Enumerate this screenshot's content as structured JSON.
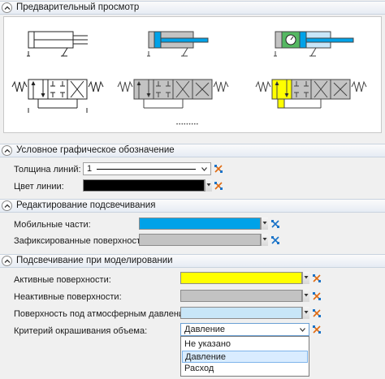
{
  "colors": {
    "accent_blue": "#00a2e8",
    "active_yellow": "#ffff00",
    "atm_lightblue": "#c8e6f8",
    "line_black": "#000000",
    "fixed_gray": "#c3c3c3"
  },
  "preview": {
    "title": "Предварительный просмотр",
    "dots": "•••••••••"
  },
  "symbol_section": {
    "title": "Условное графическое обозначение",
    "line_width_label": "Толщина линий:",
    "line_width_value": "1",
    "line_color_label": "Цвет линии:"
  },
  "highlight_edit": {
    "title": "Редактирование подсвечивания",
    "moving_parts_label": "Мобильные части:",
    "fixed_surfaces_label": "Зафиксированные поверхности:"
  },
  "sim_highlight": {
    "title": "Подсвечивание при моделировании",
    "active_surfaces_label": "Активные поверхности:",
    "inactive_surfaces_label": "Неактивные поверхности:",
    "atm_surface_label": "Поверхность под атмосферным давлением:",
    "volume_criterion_label": "Критерий окрашивания объема:",
    "volume_criterion_value": "Давление",
    "options": [
      "Не указано",
      "Давление",
      "Расход"
    ]
  }
}
